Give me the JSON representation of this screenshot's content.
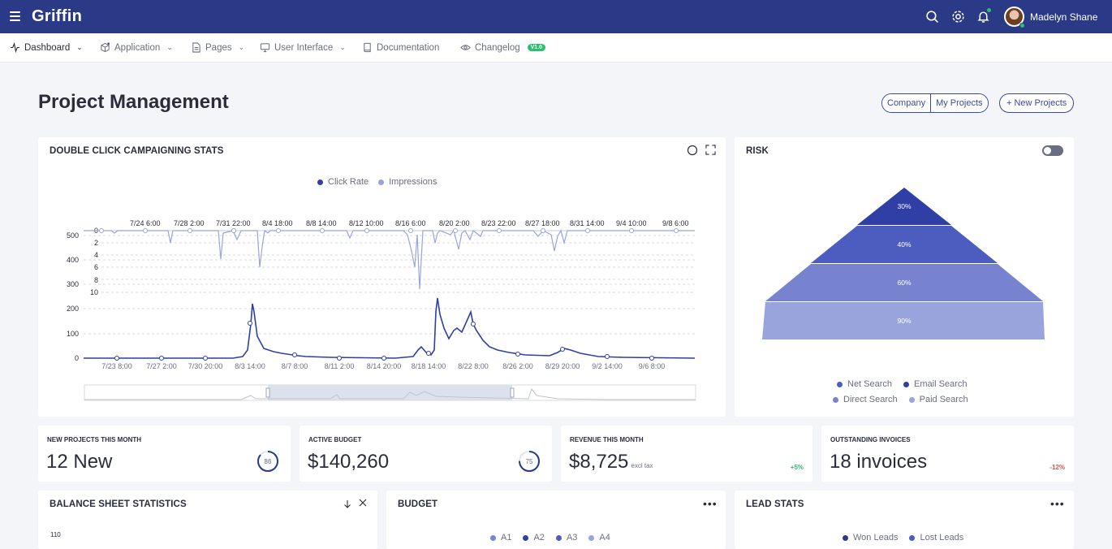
{
  "app": {
    "brand": "Griffin",
    "username": "Madelyn Shane"
  },
  "nav": {
    "items": [
      {
        "label": "Dashboard"
      },
      {
        "label": "Application"
      },
      {
        "label": "Pages"
      },
      {
        "label": "User Interface"
      },
      {
        "label": "Documentation"
      },
      {
        "label": "Changelog",
        "badge": "V1.0"
      }
    ]
  },
  "header": {
    "title": "Project Management",
    "group_buttons": [
      "Company",
      "My Projects"
    ],
    "new_button": "+ New Projects"
  },
  "campaign": {
    "title": "DOUBLE CLICK CAMPAIGNING STATS",
    "legend": [
      "Click Rate",
      "Impressions"
    ],
    "top_dates": [
      "7/24 6:00",
      "7/28 2:00",
      "7/31 22:00",
      "8/4 18:00",
      "8/8 14:00",
      "8/12 10:00",
      "8/16 6:00",
      "8/20 2:00",
      "8/23 22:00",
      "8/27 18:00",
      "8/31 14:00",
      "9/4 10:00",
      "9/8 6:00"
    ],
    "bottom_dates": [
      "7/23 8:00",
      "7/27 2:00",
      "7/30 20:00",
      "8/3 14:00",
      "8/7 8:00",
      "8/11 2:00",
      "8/14 20:00",
      "8/18 14:00",
      "8/22 8:00",
      "8/26 2:00",
      "8/29 20:00",
      "9/2 14:00",
      "9/6 8:00"
    ],
    "left_ticks": [
      "500",
      "400",
      "300",
      "200",
      "100",
      "0"
    ],
    "inner_ticks": [
      "0",
      "2",
      "4",
      "6",
      "8",
      "10"
    ]
  },
  "risk": {
    "title": "RISK",
    "levels": [
      "30%",
      "40%",
      "60%",
      "90%"
    ],
    "legend": [
      "Net Search",
      "Email Search",
      "Direct Search",
      "Paid Search"
    ]
  },
  "stats": [
    {
      "label": "NEW PROJECTS THIS MONTH",
      "value": "12 New",
      "ring": "86",
      "ring_pct": 86
    },
    {
      "label": "ACTIVE BUDGET",
      "value": "$140,260",
      "ring": "75",
      "ring_pct": 75
    },
    {
      "label": "REVENUE THIS MONTH",
      "value": "$8,725",
      "sub": "excl tax",
      "delta": "+5%"
    },
    {
      "label": "OUTSTANDING INVOICES",
      "value": "18 invoices",
      "delta": "-12%"
    }
  ],
  "balance": {
    "title": "BALANCE SHEET STATISTICS",
    "tick": "110"
  },
  "budget": {
    "title": "BUDGET",
    "legend": [
      "A1",
      "A2",
      "A3",
      "A4"
    ]
  },
  "lead": {
    "title": "LEAD STATS",
    "legend": [
      "Won Leads",
      "Lost Leads"
    ]
  },
  "colors": {
    "primary": "#2a3a86",
    "accent": "#3b4cb0",
    "light": "#9aa4dc",
    "green": "#2dbf71",
    "red": "#e2504c"
  }
}
